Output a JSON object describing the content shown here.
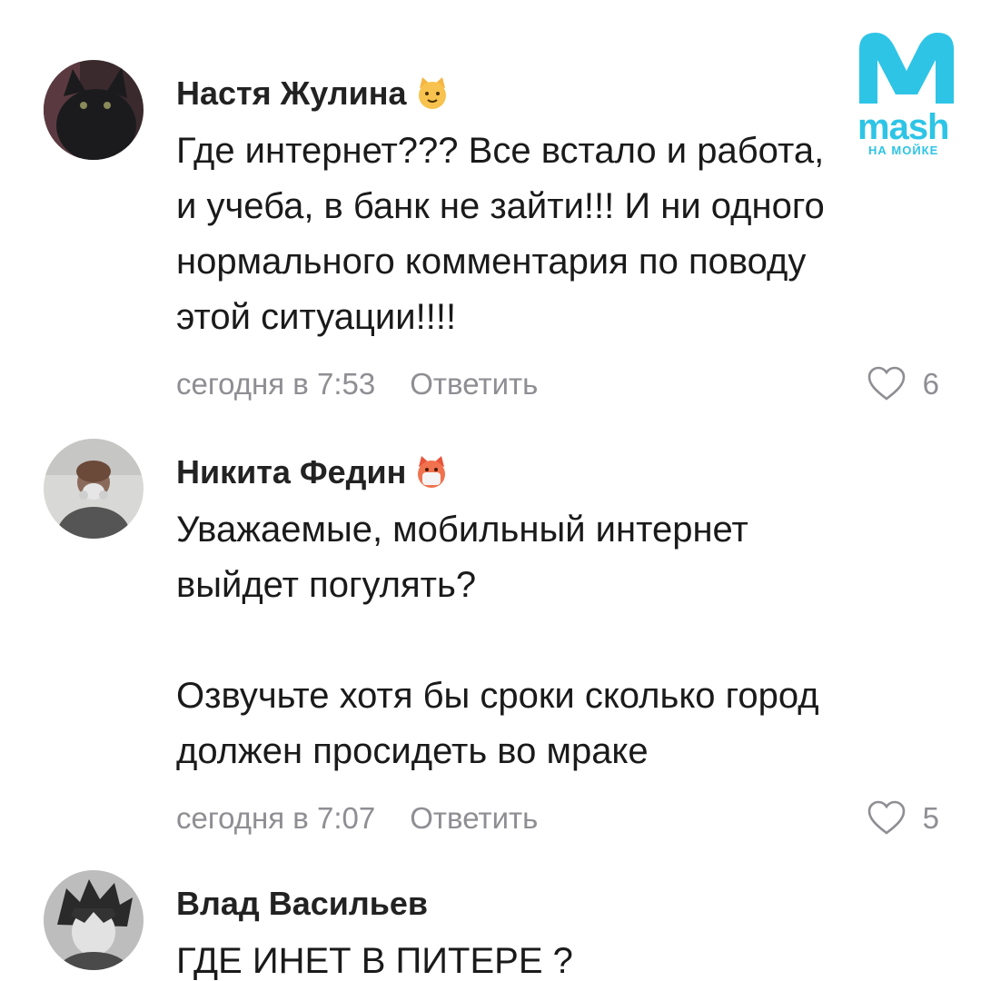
{
  "logo": {
    "word": "mash",
    "sub": "НА МОЙКЕ",
    "color": "#2ec4e6"
  },
  "comments": [
    {
      "author": "Настя Жулина",
      "emoji": "cat-face-icon",
      "text": "Где интернет??? Все встало и работа,\nи учеба, в банк не зайти!!! И ни одного\nнормального комментария по поводу\nэтой ситуации!!!!",
      "time": "сегодня в 7:53",
      "reply": "Ответить",
      "likes": "6"
    },
    {
      "author": "Никита Федин",
      "emoji": "crying-cat-face-icon",
      "text": "Уважаемые,  мобильный интернет\nвыйдет погулять?\n\n Озвучьте хотя бы сроки сколько город\nдолжен просидеть во мраке",
      "time": "сегодня в 7:07",
      "reply": "Ответить",
      "likes": "5"
    },
    {
      "author": "Влад Васильев",
      "text": "ГДЕ ИНЕТ В ПИТЕРЕ ?"
    }
  ]
}
